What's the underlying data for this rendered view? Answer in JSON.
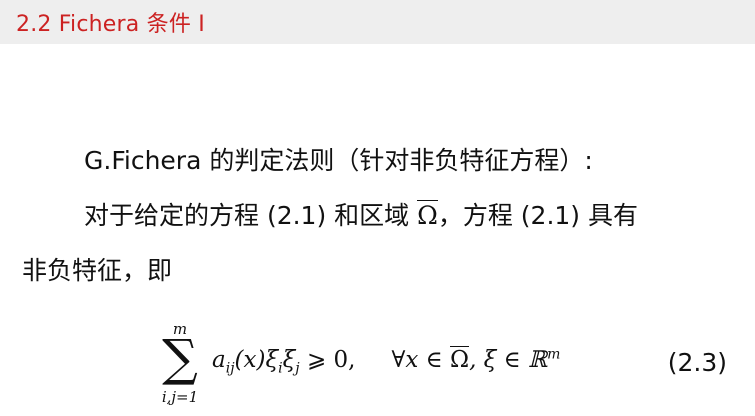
{
  "slide": {
    "title": "2.2 Fichera 条件 I"
  },
  "body": {
    "line1": "G.Fichera 的判定法则（针对非负特征方程）:",
    "line2_a": "对于给定的方程 (2.1) 和区域 ",
    "line2_omega": "Ω",
    "line2_b": "，方程 (2.1) 具有",
    "line3": "非负特征，即"
  },
  "equation": {
    "sum_upper": "m",
    "sum_symbol": "∑",
    "sum_lower": "i,j=1",
    "expression_a": "a",
    "expression_a_sub": "ij",
    "expression_b": "(x)ξ",
    "expression_b_sub": "i",
    "expression_c": "ξ",
    "expression_c_sub": "j",
    "relation": " ⩾ 0,",
    "condition_a": "∀x ∈ ",
    "condition_omega": "Ω",
    "condition_b": ", ξ ∈ ℝ",
    "condition_sup": "m",
    "number": "(2.3)"
  },
  "colors": {
    "title_text": "#cc2222",
    "title_bar": "#eeeeee",
    "body_text": "#111111"
  }
}
